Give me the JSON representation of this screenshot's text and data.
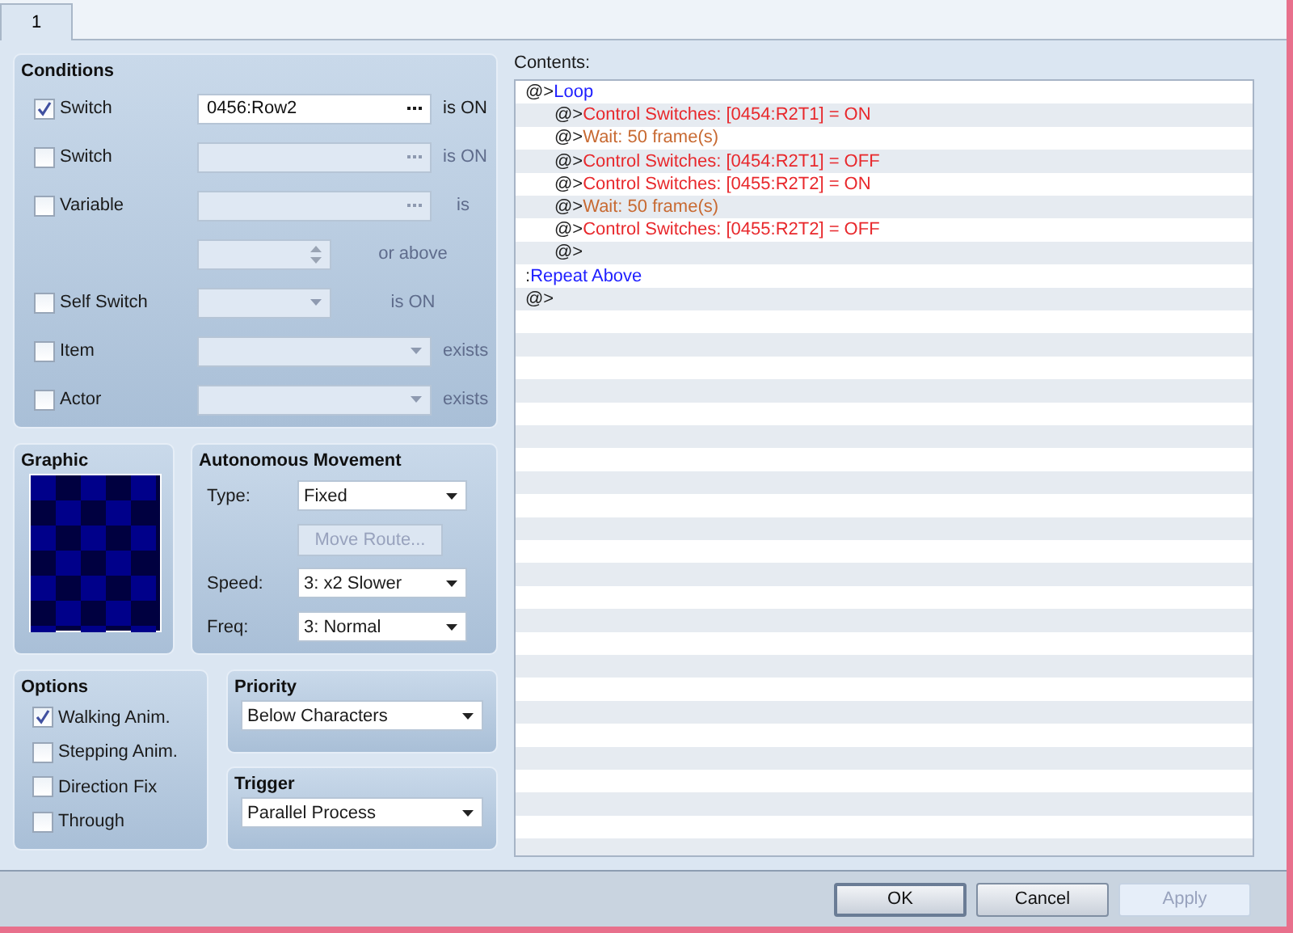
{
  "tabs": [
    {
      "label": "1",
      "selected": true
    }
  ],
  "conditions": {
    "title": "Conditions",
    "items": [
      {
        "label": "Switch",
        "checked": true,
        "kind": "picker",
        "value": "0456:Row2",
        "suffix": "is ON"
      },
      {
        "label": "Switch",
        "checked": false,
        "kind": "picker",
        "suffix": "is ON"
      },
      {
        "label": "Variable",
        "checked": false,
        "kind": "picker",
        "suffix": "is",
        "extra": {
          "kind": "spin",
          "suffix": "or above"
        }
      },
      {
        "label": "Self Switch",
        "checked": false,
        "kind": "dropdown-short",
        "suffix": "is ON"
      },
      {
        "label": "Item",
        "checked": false,
        "kind": "dropdown",
        "suffix": "exists"
      },
      {
        "label": "Actor",
        "checked": false,
        "kind": "dropdown",
        "suffix": "exists"
      }
    ]
  },
  "graphic": {
    "title": "Graphic"
  },
  "movement": {
    "title": "Autonomous Movement",
    "type_label": "Type:",
    "type": "Fixed",
    "route_button": {
      "label": "Move Route...",
      "disabled": true
    },
    "speed_label": "Speed:",
    "speed": "3: x2 Slower",
    "freq_label": "Freq:",
    "freq": "3: Normal"
  },
  "options": {
    "title": "Options",
    "items": [
      {
        "label": "Walking Anim.",
        "checked": true
      },
      {
        "label": "Stepping Anim.",
        "checked": false
      },
      {
        "label": "Direction Fix",
        "checked": false
      },
      {
        "label": "Through",
        "checked": false
      }
    ]
  },
  "priority": {
    "title": "Priority",
    "value": "Below Characters"
  },
  "trigger": {
    "title": "Trigger",
    "value": "Parallel Process"
  },
  "contents": {
    "label": "Contents:",
    "lines": [
      {
        "prefix": "@>",
        "text": "Loop",
        "kind": "flow",
        "children": [
          {
            "prefix": "@>",
            "text": "Control Switches: [0454:R2T1] = ON",
            "kind": "switch"
          },
          {
            "prefix": "@>",
            "text": "Wait: 50 frame(s)",
            "kind": "wait"
          },
          {
            "prefix": "@>",
            "text": "Control Switches: [0454:R2T1] = OFF",
            "kind": "switch"
          },
          {
            "prefix": "@>",
            "text": "Control Switches: [0455:R2T2] = ON",
            "kind": "switch"
          },
          {
            "prefix": "@>",
            "text": "Wait: 50 frame(s)",
            "kind": "wait"
          },
          {
            "prefix": "@>",
            "text": "Control Switches: [0455:R2T2] = OFF",
            "kind": "switch"
          },
          {
            "prefix": "@>",
            "kind": "empty"
          }
        ]
      },
      {
        "prefix": ":",
        "text": "Repeat Above",
        "kind": "flow"
      },
      {
        "prefix": "@>",
        "kind": "empty"
      }
    ]
  },
  "buttons": [
    {
      "label": "OK",
      "kind": "default",
      "disabled": false
    },
    {
      "label": "Cancel",
      "kind": "normal",
      "disabled": false
    },
    {
      "label": "Apply",
      "kind": "normal",
      "disabled": true
    }
  ]
}
